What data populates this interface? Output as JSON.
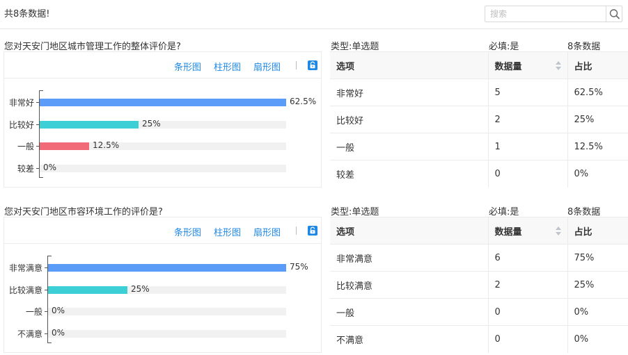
{
  "header": {
    "total_text": "共8条数据!",
    "search_placeholder": "搜索",
    "search_value": ""
  },
  "colors": {
    "blue": "#5b9cf8",
    "teal": "#3dcfd6",
    "red": "#f06a78",
    "link": "#1e88e5",
    "track": "#f1f1f1"
  },
  "icons": {
    "search": "search-icon",
    "lock": "lock-icon",
    "sort": "sort-icon"
  },
  "questions": [
    {
      "title": "您对天安门地区城市管理工作的整体评价是?",
      "type_label": "类型:单选题",
      "required_label": "必填:是",
      "count_label": "8条数据",
      "views": [
        "条形图",
        "柱形图",
        "扇形图"
      ],
      "table_headers": [
        "选项",
        "数据量",
        "占比"
      ],
      "rows": [
        {
          "option": "非常好",
          "count": "5",
          "percent": "62.5%"
        },
        {
          "option": "比较好",
          "count": "2",
          "percent": "25%"
        },
        {
          "option": "一般",
          "count": "1",
          "percent": "12.5%"
        },
        {
          "option": "较差",
          "count": "0",
          "percent": "0%"
        }
      ]
    },
    {
      "title": "您对天安门地区市容环境工作的评价是?",
      "type_label": "类型:单选题",
      "required_label": "必填:是",
      "count_label": "8条数据",
      "views": [
        "条形图",
        "柱形图",
        "扇形图"
      ],
      "table_headers": [
        "选项",
        "数据量",
        "占比"
      ],
      "rows": [
        {
          "option": "非常满意",
          "count": "6",
          "percent": "75%"
        },
        {
          "option": "比较满意",
          "count": "2",
          "percent": "25%"
        },
        {
          "option": "一般",
          "count": "0",
          "percent": "0%"
        },
        {
          "option": "不满意",
          "count": "0",
          "percent": "0%"
        }
      ]
    }
  ],
  "chart_data": [
    {
      "type": "bar",
      "orientation": "horizontal",
      "categories": [
        "非常好",
        "比较好",
        "一般",
        "较差"
      ],
      "values": [
        62.5,
        25,
        12.5,
        0
      ],
      "value_labels": [
        "62.5%",
        "25%",
        "12.5%",
        "0%"
      ],
      "bar_colors": [
        "#5b9cf8",
        "#3dcfd6",
        "#f06a78",
        "#f06a78"
      ],
      "xlim": [
        0,
        62.5
      ],
      "grid": false,
      "legend": "none"
    },
    {
      "type": "bar",
      "orientation": "horizontal",
      "categories": [
        "非常满意",
        "比较满意",
        "一般",
        "不满意"
      ],
      "values": [
        75,
        25,
        0,
        0
      ],
      "value_labels": [
        "75%",
        "25%",
        "0%",
        "0%"
      ],
      "bar_colors": [
        "#5b9cf8",
        "#3dcfd6",
        "#f06a78",
        "#f06a78"
      ],
      "xlim": [
        0,
        75
      ],
      "grid": false,
      "legend": "none"
    }
  ]
}
